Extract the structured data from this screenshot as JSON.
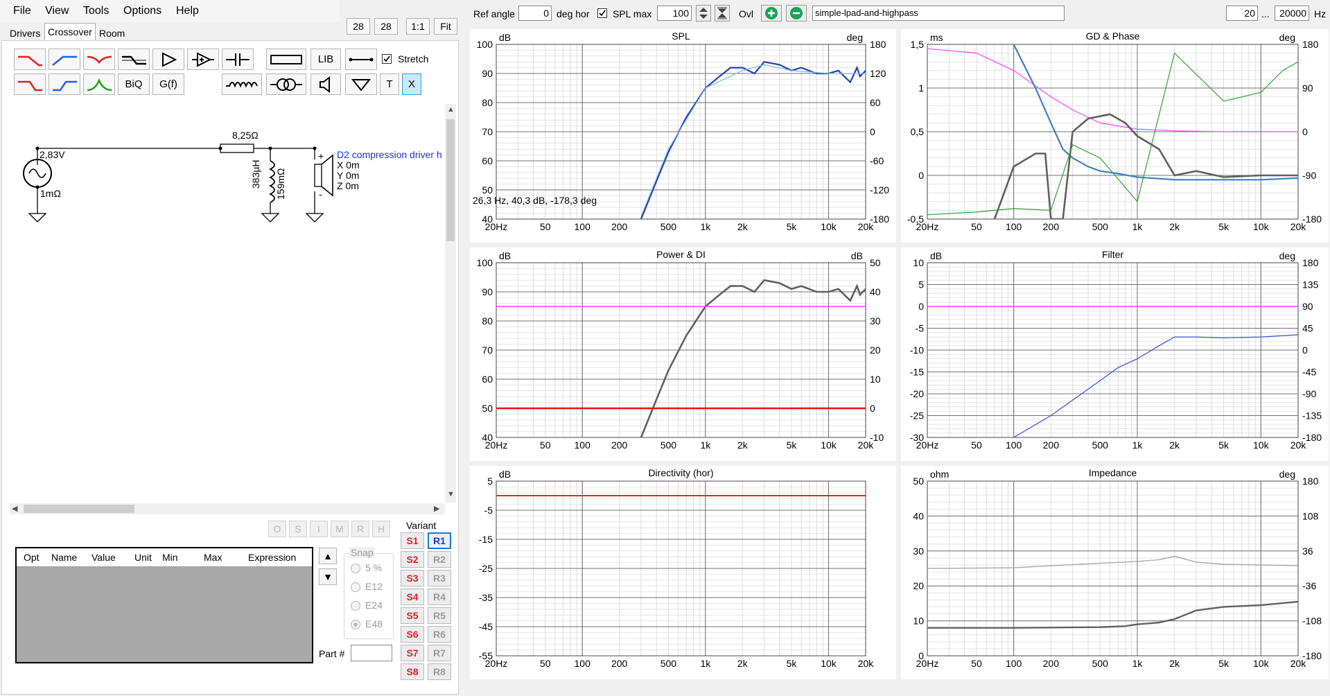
{
  "menu": [
    "File",
    "View",
    "Tools",
    "Options",
    "Help"
  ],
  "tabs": [
    "Drivers",
    "Crossover",
    "Room"
  ],
  "zoom_buttons": [
    "28",
    "28",
    "1:1",
    "Fit"
  ],
  "toolbar": {
    "lib": "LIB",
    "biq": "BiQ",
    "gf": "G(f)",
    "t": "T",
    "x": "X",
    "stretch": "Stretch"
  },
  "schematic": {
    "source_voltage": "2,83V",
    "source_resistance": "1mΩ",
    "resistor": "8,25Ω",
    "inductor_value": "383µH",
    "inductor_resistance": "159mΩ",
    "driver_name": "D2 compression driver h",
    "driver_x": "X 0m",
    "driver_y": "Y 0m",
    "driver_z": "Z 0m"
  },
  "opt_buttons": [
    "O",
    "S",
    "I",
    "M",
    "R",
    "H"
  ],
  "param_table": {
    "headers": [
      "Opt",
      "Name",
      "Value",
      "Unit",
      "Min",
      "Max",
      "Expression"
    ]
  },
  "snap": {
    "title": "Snap",
    "options": [
      "5 %",
      "E12",
      "E24",
      "E48"
    ],
    "selected": "E48"
  },
  "part_label": "Part #",
  "variant": {
    "title": "Variant",
    "s": [
      "S1",
      "S2",
      "S3",
      "S4",
      "S5",
      "S6",
      "S7",
      "S8"
    ],
    "r": [
      "R1",
      "R2",
      "R3",
      "R4",
      "R5",
      "R6",
      "R7",
      "R8"
    ],
    "selected": "R1"
  },
  "topbar": {
    "ref_angle_label": "Ref angle",
    "ref_angle": "0",
    "deg_hor": "deg hor",
    "spl_max_label": "SPL max",
    "spl_max": "100",
    "ovl": "Ovl",
    "project": "simple-lpad-and-highpass",
    "f_min": "20",
    "ellipsis": "...",
    "f_max": "20000",
    "hz": "Hz"
  },
  "freq_ticks": [
    "20Hz",
    "50",
    "100",
    "200",
    "500",
    "1k",
    "2k",
    "5k",
    "10k",
    "20k"
  ],
  "freq_values": [
    20,
    50,
    100,
    200,
    500,
    1000,
    2000,
    5000,
    10000,
    20000
  ],
  "charts": {
    "spl": {
      "title": "SPL",
      "unit_left": "dB",
      "unit_right": "deg",
      "ylim": [
        40,
        100
      ],
      "yticks": [
        "100",
        "90",
        "80",
        "70",
        "60",
        "50",
        "40"
      ],
      "y2ticks": [
        "180",
        "120",
        "60",
        "0",
        "-60",
        "-120",
        "-180"
      ],
      "readout": "26,3 Hz, 40,3 dB, -178,3 deg"
    },
    "gd": {
      "title": "GD & Phase",
      "unit_left": "ms",
      "unit_right": "deg",
      "ylim": [
        -0.5,
        1.5
      ],
      "yticks": [
        "1,5",
        "1",
        "0,5",
        "0",
        "-0,5"
      ],
      "y2ticks": [
        "180",
        "90",
        "0",
        "-90",
        "-180"
      ]
    },
    "power": {
      "title": "Power & DI",
      "unit_left": "dB",
      "unit_right": "dB",
      "ylim": [
        40,
        100
      ],
      "yticks": [
        "100",
        "90",
        "80",
        "70",
        "60",
        "50",
        "40"
      ],
      "y2ticks": [
        "50",
        "40",
        "30",
        "20",
        "10",
        "0",
        "-10"
      ]
    },
    "filter": {
      "title": "Filter",
      "unit_left": "dB",
      "unit_right": "deg",
      "ylim": [
        -30,
        10
      ],
      "yticks": [
        "10",
        "5",
        "0",
        "-5",
        "-10",
        "-15",
        "-20",
        "-25",
        "-30"
      ],
      "y2ticks": [
        "180",
        "135",
        "90",
        "45",
        "0",
        "-45",
        "-90",
        "-135",
        "-180"
      ]
    },
    "directivity": {
      "title": "Directivity (hor)",
      "unit_left": "dB",
      "ylim": [
        -55,
        5
      ],
      "yticks": [
        "5",
        "-5",
        "-15",
        "-25",
        "-35",
        "-45",
        "-55"
      ]
    },
    "impedance": {
      "title": "Impedance",
      "unit_left": "ohm",
      "unit_right": "deg",
      "ylim": [
        0,
        50
      ],
      "yticks": [
        "50",
        "40",
        "30",
        "20",
        "10",
        "0"
      ],
      "y2ticks": [
        "180",
        "108",
        "36",
        "-36",
        "-108",
        "-180"
      ]
    }
  },
  "chart_data": [
    {
      "type": "line",
      "title": "SPL",
      "xlabel": "",
      "ylabel": "dB",
      "xscale": "log",
      "xlim": [
        20,
        20000
      ],
      "ylim": [
        40,
        100
      ],
      "series": [
        {
          "color": "#1f3fbf",
          "x": [
            300,
            400,
            500,
            700,
            1000,
            1300,
            1600,
            2000,
            2500,
            3000,
            4000,
            5000,
            6000,
            8000,
            10000,
            12000,
            15000,
            17000,
            18000,
            20000
          ],
          "y": [
            40,
            53,
            63,
            75,
            85,
            89,
            92,
            92,
            90,
            94,
            93,
            91,
            92,
            90,
            90,
            91,
            87,
            92,
            89,
            91
          ]
        },
        {
          "color": "#7fb8e8",
          "x": [
            300,
            500,
            1000,
            2000,
            3000,
            5000,
            10000,
            20000
          ],
          "y": [
            41,
            64,
            85,
            91,
            93,
            91,
            90,
            90
          ]
        }
      ]
    },
    {
      "type": "line",
      "title": "GD & Phase",
      "xscale": "log",
      "xlim": [
        20,
        20000
      ],
      "ylim": [
        -0.5,
        1.5
      ],
      "series": [
        {
          "color": "#ff40ff",
          "x": [
            20,
            50,
            100,
            200,
            300,
            500,
            1000,
            2000,
            5000,
            20000
          ],
          "y": [
            1.45,
            1.4,
            1.2,
            0.9,
            0.75,
            0.6,
            0.53,
            0.51,
            0.5,
            0.5
          ]
        },
        {
          "color": "#3d7fc4",
          "x": [
            100,
            150,
            200,
            250,
            300,
            400,
            500,
            700,
            1000,
            2000,
            5000,
            10000,
            20000
          ],
          "y": [
            1.5,
            1.0,
            0.6,
            0.3,
            0.2,
            0.1,
            0.05,
            0.02,
            -0.02,
            -0.05,
            -0.05,
            -0.05,
            -0.03
          ]
        },
        {
          "color": "#606060",
          "x": [
            70,
            100,
            150,
            180,
            200,
            250,
            300,
            400,
            600,
            800,
            1000,
            1500,
            2000,
            3000,
            5000,
            10000,
            20000
          ],
          "y": [
            -0.5,
            0.1,
            0.25,
            0.25,
            -0.5,
            -0.5,
            0.5,
            0.65,
            0.7,
            0.6,
            0.45,
            0.3,
            0.0,
            0.05,
            -0.02,
            0.0,
            0.0
          ]
        },
        {
          "color": "#30a030",
          "x": [
            20,
            50,
            100,
            200,
            300,
            500,
            1000,
            2000,
            5000,
            10000,
            15000,
            20000
          ],
          "y": [
            -0.45,
            -0.42,
            -0.38,
            -0.4,
            0.35,
            0.2,
            -0.3,
            1.4,
            0.85,
            0.95,
            1.2,
            1.3
          ]
        }
      ]
    },
    {
      "type": "line",
      "title": "Power & DI",
      "xscale": "log",
      "xlim": [
        20,
        20000
      ],
      "ylim": [
        40,
        100
      ],
      "series": [
        {
          "color": "#606060",
          "x": [
            300,
            400,
            500,
            700,
            1000,
            1300,
            1600,
            2000,
            2500,
            3000,
            4000,
            5000,
            6000,
            8000,
            10000,
            12000,
            15000,
            17000,
            18000,
            20000
          ],
          "y": [
            40,
            53,
            63,
            75,
            85,
            89,
            92,
            92,
            90,
            94,
            93,
            91,
            92,
            90,
            90,
            91,
            87,
            92,
            89,
            91
          ]
        },
        {
          "color": "#ff40ff",
          "x": [
            20,
            20000
          ],
          "y": [
            85,
            85
          ]
        },
        {
          "color": "#ee1111",
          "x": [
            20,
            20000
          ],
          "y": [
            50,
            50
          ]
        }
      ]
    },
    {
      "type": "line",
      "title": "Filter",
      "xscale": "log",
      "xlim": [
        20,
        20000
      ],
      "ylim": [
        -30,
        10
      ],
      "series": [
        {
          "color": "#ff40ff",
          "x": [
            20,
            20000
          ],
          "y": [
            0,
            0
          ]
        },
        {
          "color": "#3050e0",
          "x": [
            100,
            200,
            500,
            700,
            1000,
            1500,
            2000,
            3000,
            5000,
            10000,
            20000
          ],
          "y": [
            -30,
            -25,
            -17,
            -14,
            -12,
            -9,
            -7,
            -7,
            -7.2,
            -7,
            -6.5
          ]
        }
      ]
    },
    {
      "type": "line",
      "title": "Directivity (hor)",
      "xscale": "log",
      "xlim": [
        20,
        20000
      ],
      "ylim": [
        -55,
        5
      ],
      "series": [
        {
          "color": "#d03010",
          "x": [
            20,
            20000
          ],
          "y": [
            0,
            0
          ]
        }
      ]
    },
    {
      "type": "line",
      "title": "Impedance",
      "xscale": "log",
      "xlim": [
        20,
        20000
      ],
      "ylim": [
        0,
        50
      ],
      "series": [
        {
          "color": "#a8a8a8",
          "x": [
            20,
            100,
            500,
            1000,
            1500,
            2000,
            3000,
            5000,
            10000,
            20000
          ],
          "y": [
            25,
            25.2,
            26.5,
            27,
            27.5,
            28.5,
            26.8,
            26.2,
            26,
            25.8
          ]
        },
        {
          "color": "#606060",
          "x": [
            20,
            100,
            500,
            800,
            1000,
            1500,
            2000,
            3000,
            5000,
            10000,
            20000
          ],
          "y": [
            8,
            8,
            8.2,
            8.5,
            9,
            9.5,
            10.5,
            13,
            14,
            14.5,
            15.5
          ]
        }
      ]
    }
  ]
}
